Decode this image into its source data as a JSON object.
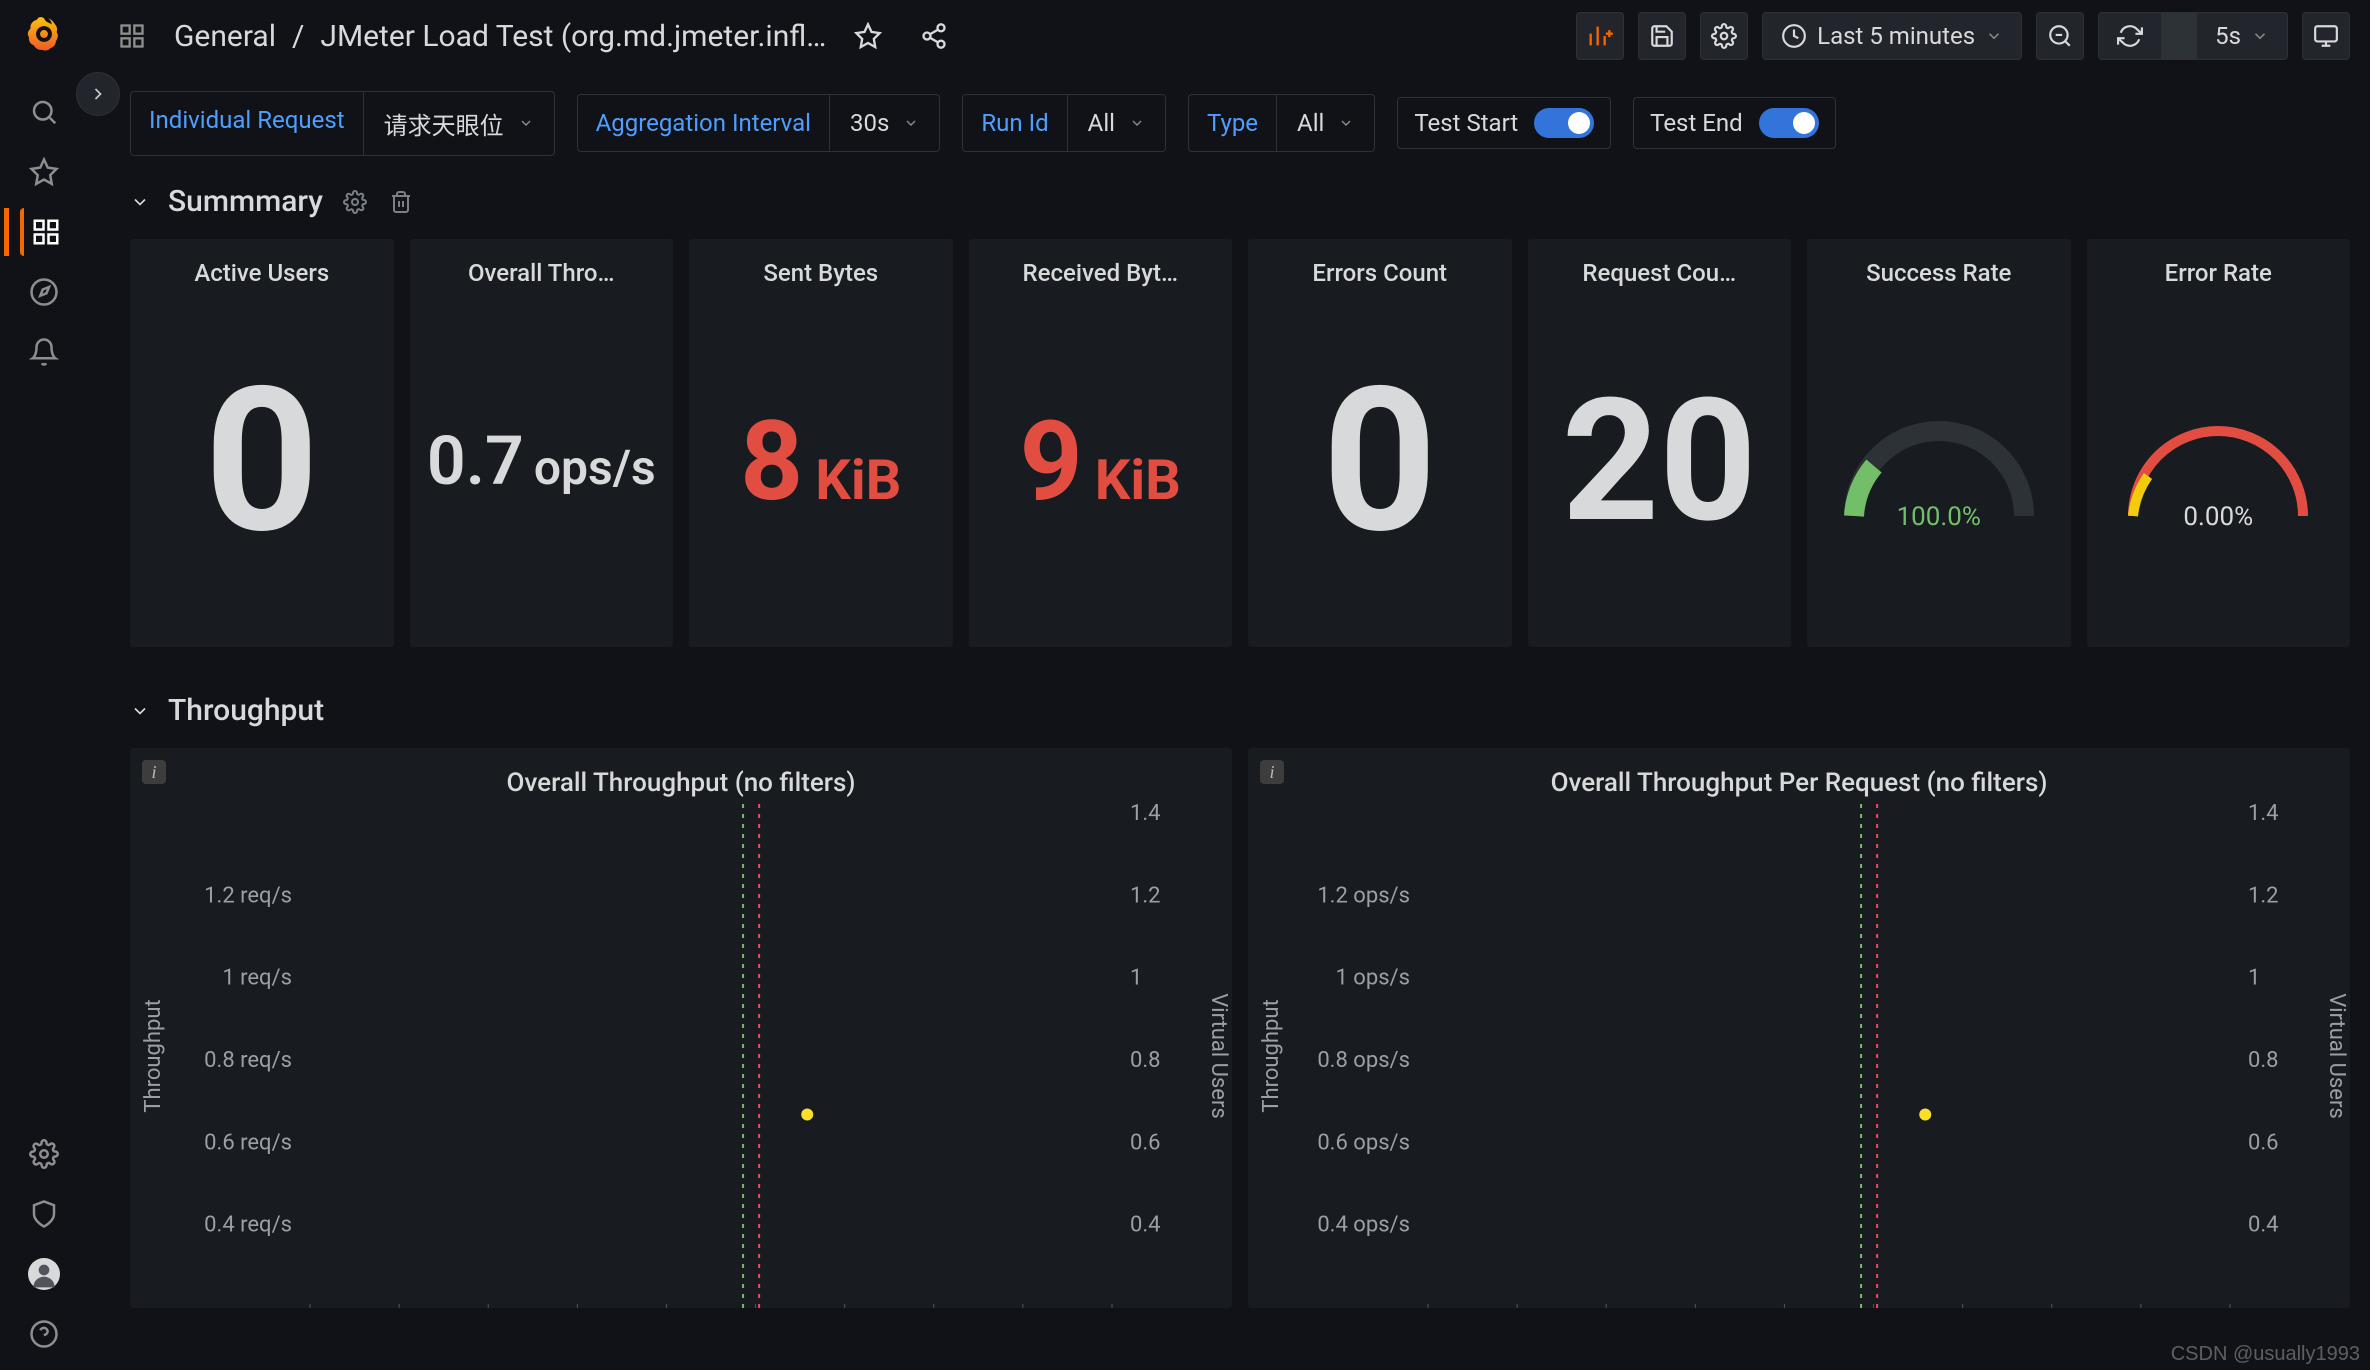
{
  "breadcrumb": {
    "folder": "General",
    "sep": "/",
    "title": "JMeter Load Test (org.md.jmeter.infl…"
  },
  "time": {
    "range_label": "Last 5 minutes",
    "refresh_label": "5s"
  },
  "vars": [
    {
      "label": "Individual Request",
      "value": "请求天眼位"
    },
    {
      "label": "Aggregation Interval",
      "value": "30s"
    },
    {
      "label": "Run Id",
      "value": "All"
    },
    {
      "label": "Type",
      "value": "All"
    }
  ],
  "toggles": [
    {
      "label": "Test Start",
      "on": true
    },
    {
      "label": "Test End",
      "on": true
    }
  ],
  "rows": {
    "summary": "Summmary",
    "throughput": "Throughput"
  },
  "panels": {
    "active_users": {
      "title": "Active Users",
      "value": "0"
    },
    "overall_thr": {
      "title": "Overall Thro…",
      "value": "0.7",
      "unit": "ops/s"
    },
    "sent_bytes": {
      "title": "Sent Bytes",
      "value": "8",
      "unit": "KiB"
    },
    "received_bytes": {
      "title": "Received Byt…",
      "value": "9",
      "unit": "KiB"
    },
    "errors_count": {
      "title": "Errors Count",
      "value": "0"
    },
    "request_count": {
      "title": "Request Cou…",
      "value": "20"
    },
    "success_rate": {
      "title": "Success Rate",
      "value": "100.0%"
    },
    "error_rate": {
      "title": "Error Rate",
      "value": "0.00%"
    }
  },
  "charts": {
    "overall": {
      "title": "Overall Throughput (no filters)",
      "left_axis": "Throughput",
      "right_axis": "Virtual Users"
    },
    "perrequest": {
      "title": "Overall Throughput Per Request (no filters)",
      "left_axis": "Throughput",
      "right_axis": "Virtual Users"
    }
  },
  "chart_data": [
    {
      "type": "line",
      "id": "overall",
      "title": "Overall Throughput (no filters)",
      "x_domain": "time (5 min window, 10 ticks)",
      "left_axis": {
        "label": "Throughput",
        "unit": "req/s",
        "ticks": [
          "0.4 req/s",
          "0.6 req/s",
          "0.8 req/s",
          "1 req/s",
          "1.2 req/s"
        ]
      },
      "right_axis": {
        "label": "Virtual Users",
        "ticks": [
          "0.4",
          "0.6",
          "0.8",
          "1",
          "1.2",
          "1.4"
        ]
      },
      "annotations": {
        "test_start_line": {
          "x_rel": 0.54,
          "color": "#73bf69"
        },
        "test_end_line": {
          "x_rel": 0.56,
          "color": "#f2495c"
        }
      },
      "series": [
        {
          "name": "Throughput",
          "color": "#fade2a",
          "points": [
            {
              "x_rel": 0.62,
              "y": 0.67
            }
          ]
        }
      ]
    },
    {
      "type": "line",
      "id": "perrequest",
      "title": "Overall Throughput Per Request (no filters)",
      "x_domain": "time (5 min window, 10 ticks)",
      "left_axis": {
        "label": "Throughput",
        "unit": "ops/s",
        "ticks": [
          "0.4 ops/s",
          "0.6 ops/s",
          "0.8 ops/s",
          "1 ops/s",
          "1.2 ops/s"
        ]
      },
      "right_axis": {
        "label": "Virtual Users",
        "ticks": [
          "0.4",
          "0.6",
          "0.8",
          "1",
          "1.2",
          "1.4"
        ]
      },
      "annotations": {
        "test_start_line": {
          "x_rel": 0.54,
          "color": "#73bf69"
        },
        "test_end_line": {
          "x_rel": 0.56,
          "color": "#f2495c"
        }
      },
      "series": [
        {
          "name": "Throughput",
          "color": "#fade2a",
          "points": [
            {
              "x_rel": 0.62,
              "y": 0.67
            }
          ]
        }
      ]
    }
  ],
  "watermark": "CSDN @usually1993"
}
